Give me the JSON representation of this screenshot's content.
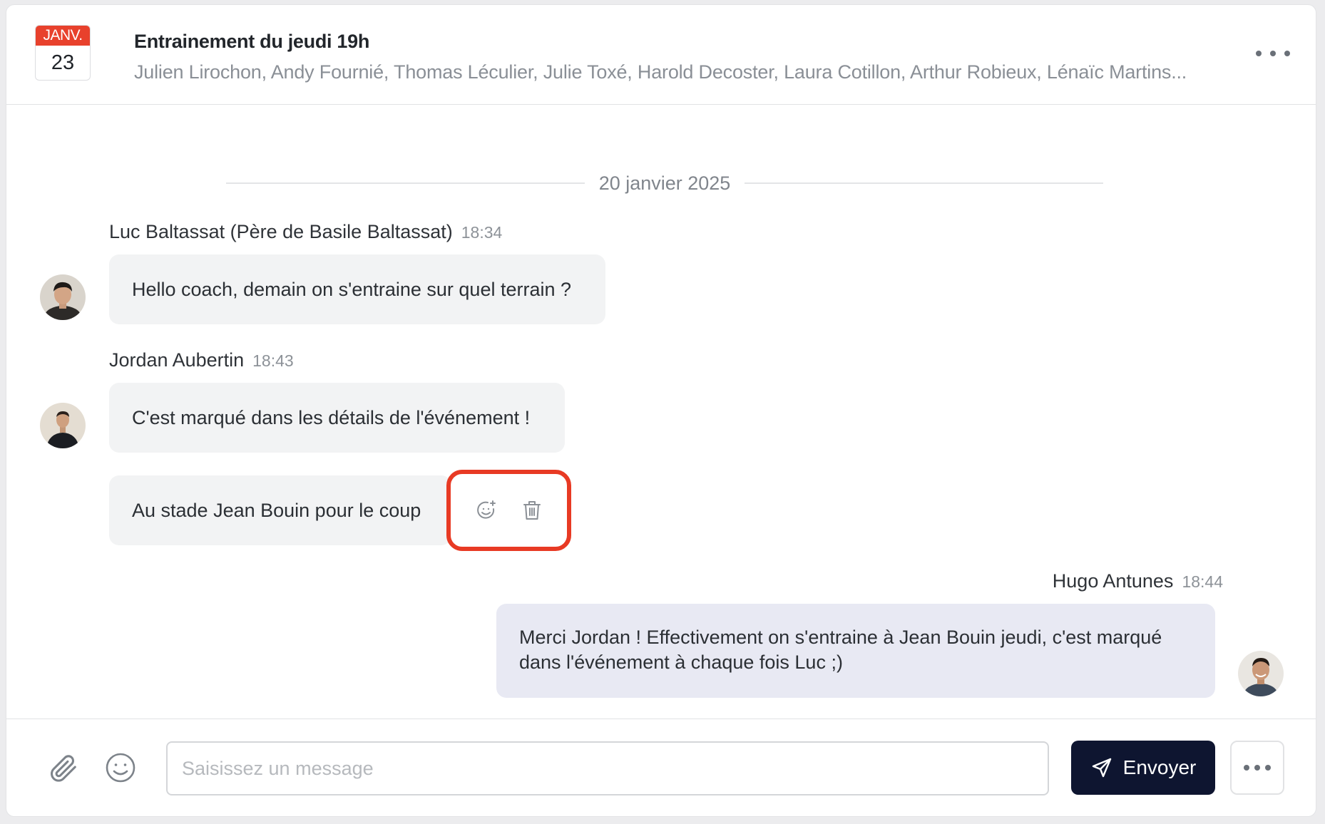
{
  "event": {
    "month": "JANV.",
    "day": "23",
    "title": "Entrainement du jeudi 19h",
    "participants": "Julien Lirochon, Andy Fournié, Thomas Léculier, Julie Toxé, Harold Decoster, Laura Cotillon, Arthur Robieux, Lénaïc Martins..."
  },
  "date_separator": "20 janvier 2025",
  "messages": [
    {
      "sender": "Luc Baltassat (Père de Basile Baltassat)",
      "time": "18:34",
      "texts": [
        "Hello coach, demain on s'entraine sur quel terrain ?"
      ]
    },
    {
      "sender": "Jordan Aubertin",
      "time": "18:43",
      "texts": [
        "C'est marqué dans les détails de l'événement !",
        "Au stade Jean Bouin pour le coup"
      ]
    },
    {
      "sender": "Hugo Antunes",
      "time": "18:44",
      "texts": [
        "Merci Jordan ! Effectivement on s'entraine à Jean Bouin jeudi, c'est marqué dans l'événement à chaque fois Luc ;)"
      ]
    }
  ],
  "message_actions": {
    "icons": [
      "add-reaction-icon",
      "trash-icon"
    ]
  },
  "composer": {
    "placeholder": "Saisissez un message",
    "send_label": "Envoyer",
    "icons": [
      "paperclip-icon",
      "emoji-icon",
      "send-icon",
      "more-icon"
    ]
  },
  "colors": {
    "calendar_red": "#e8412c",
    "send_button": "#0e1530",
    "highlight": "#e83a24",
    "my_bubble": "#e8e9f3"
  }
}
